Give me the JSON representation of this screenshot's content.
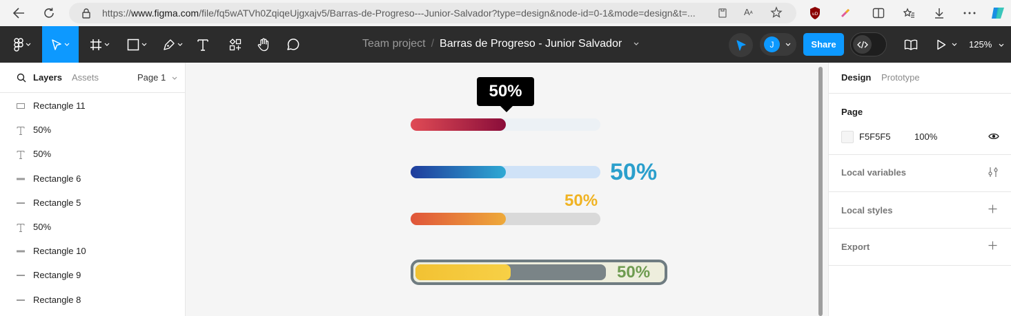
{
  "browser": {
    "url_prefix": "https://",
    "url_host": "www.figma.com",
    "url_rest": "/file/fq5wATVh0ZqiqeUjgxajv5/Barras-de-Progreso---Junior-Salvador?type=design&node-id=0-1&mode=design&t=...",
    "icons": [
      "back-icon",
      "refresh-icon",
      "lock-icon",
      "reader-icon",
      "read-aloud-icon",
      "favorite-icon",
      "ublock-icon",
      "extension-icon",
      "split-screen-icon",
      "collections-icon",
      "downloads-icon",
      "more-icon",
      "copilot-icon"
    ]
  },
  "toolbar": {
    "team": "Team project",
    "separator": "/",
    "file_name": "Barras de Progreso - Junior Salvador",
    "share_label": "Share",
    "avatar_initial": "J",
    "zoom": "125%"
  },
  "left_panel": {
    "tabs": {
      "layers": "Layers",
      "assets": "Assets",
      "page": "Page 1"
    },
    "layers": [
      {
        "name": "Rectangle 11",
        "icon": "rectangle-icon"
      },
      {
        "name": "50%",
        "icon": "text-icon"
      },
      {
        "name": "50%",
        "icon": "text-icon"
      },
      {
        "name": "Rectangle 6",
        "icon": "line-icon"
      },
      {
        "name": "Rectangle 5",
        "icon": "line-icon"
      },
      {
        "name": "50%",
        "icon": "text-icon"
      },
      {
        "name": "Rectangle 10",
        "icon": "line-icon"
      },
      {
        "name": "Rectangle 9",
        "icon": "line-icon"
      },
      {
        "name": "Rectangle 8",
        "icon": "line-icon"
      }
    ]
  },
  "canvas": {
    "background": "#F5F5F5",
    "bars": [
      {
        "label": "50%",
        "progress": 0.5,
        "fill_start": "#E04B55",
        "fill_end": "#8A0D3A",
        "track": "#ECF1F5",
        "label_color": "#FFFFFF",
        "label_style": "tooltip"
      },
      {
        "label": "50%",
        "progress": 0.5,
        "fill_start": "#1F3C9C",
        "fill_end": "#2FA9D4",
        "track": "#CFE2F7",
        "label_color": "#2B9FCC",
        "label_style": "right"
      },
      {
        "label": "50%",
        "progress": 0.5,
        "fill_start": "#E0553A",
        "fill_end": "#EEAA3A",
        "track": "#D9D9D9",
        "label_color": "#F0B323",
        "label_style": "above"
      },
      {
        "label": "50%",
        "progress": 0.5,
        "fill_start": "#F2C233",
        "fill_end": "#F7D046",
        "track": "#7A8487",
        "label_color": "#6E9B50",
        "label_style": "inside-frame",
        "frame_color": "#6F7C81",
        "frame_bg": "#EEEEDD"
      }
    ]
  },
  "right_panel": {
    "tabs": {
      "design": "Design",
      "prototype": "Prototype"
    },
    "page_heading": "Page",
    "page_color": "F5F5F5",
    "page_opacity": "100%",
    "local_variables": "Local variables",
    "local_styles": "Local styles",
    "export": "Export"
  }
}
